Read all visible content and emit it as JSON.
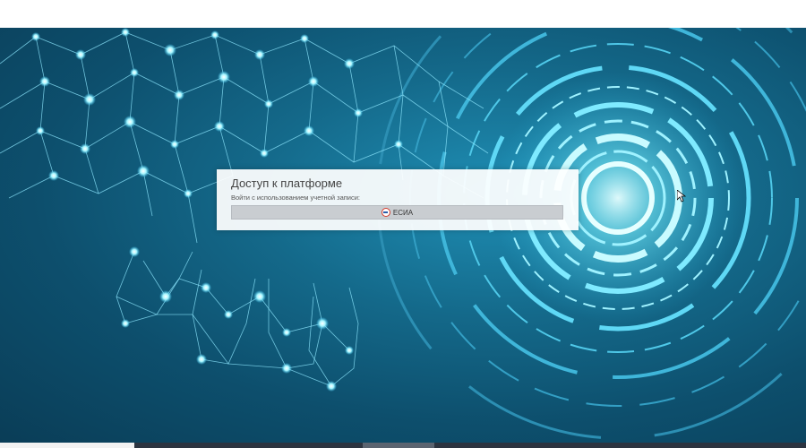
{
  "login": {
    "title": "Доступ к платформе",
    "subtitle": "Войти с использованием учетной записи:",
    "button_label": "ЕСИА",
    "button_icon": "esia-logo-icon"
  },
  "colors": {
    "background_dark": "#0a3d57",
    "background_glow": "#1f8fb5",
    "network_lines": "#8fe8ff",
    "card_bg": "#ffffff",
    "button_bg": "#c9cdd1"
  }
}
